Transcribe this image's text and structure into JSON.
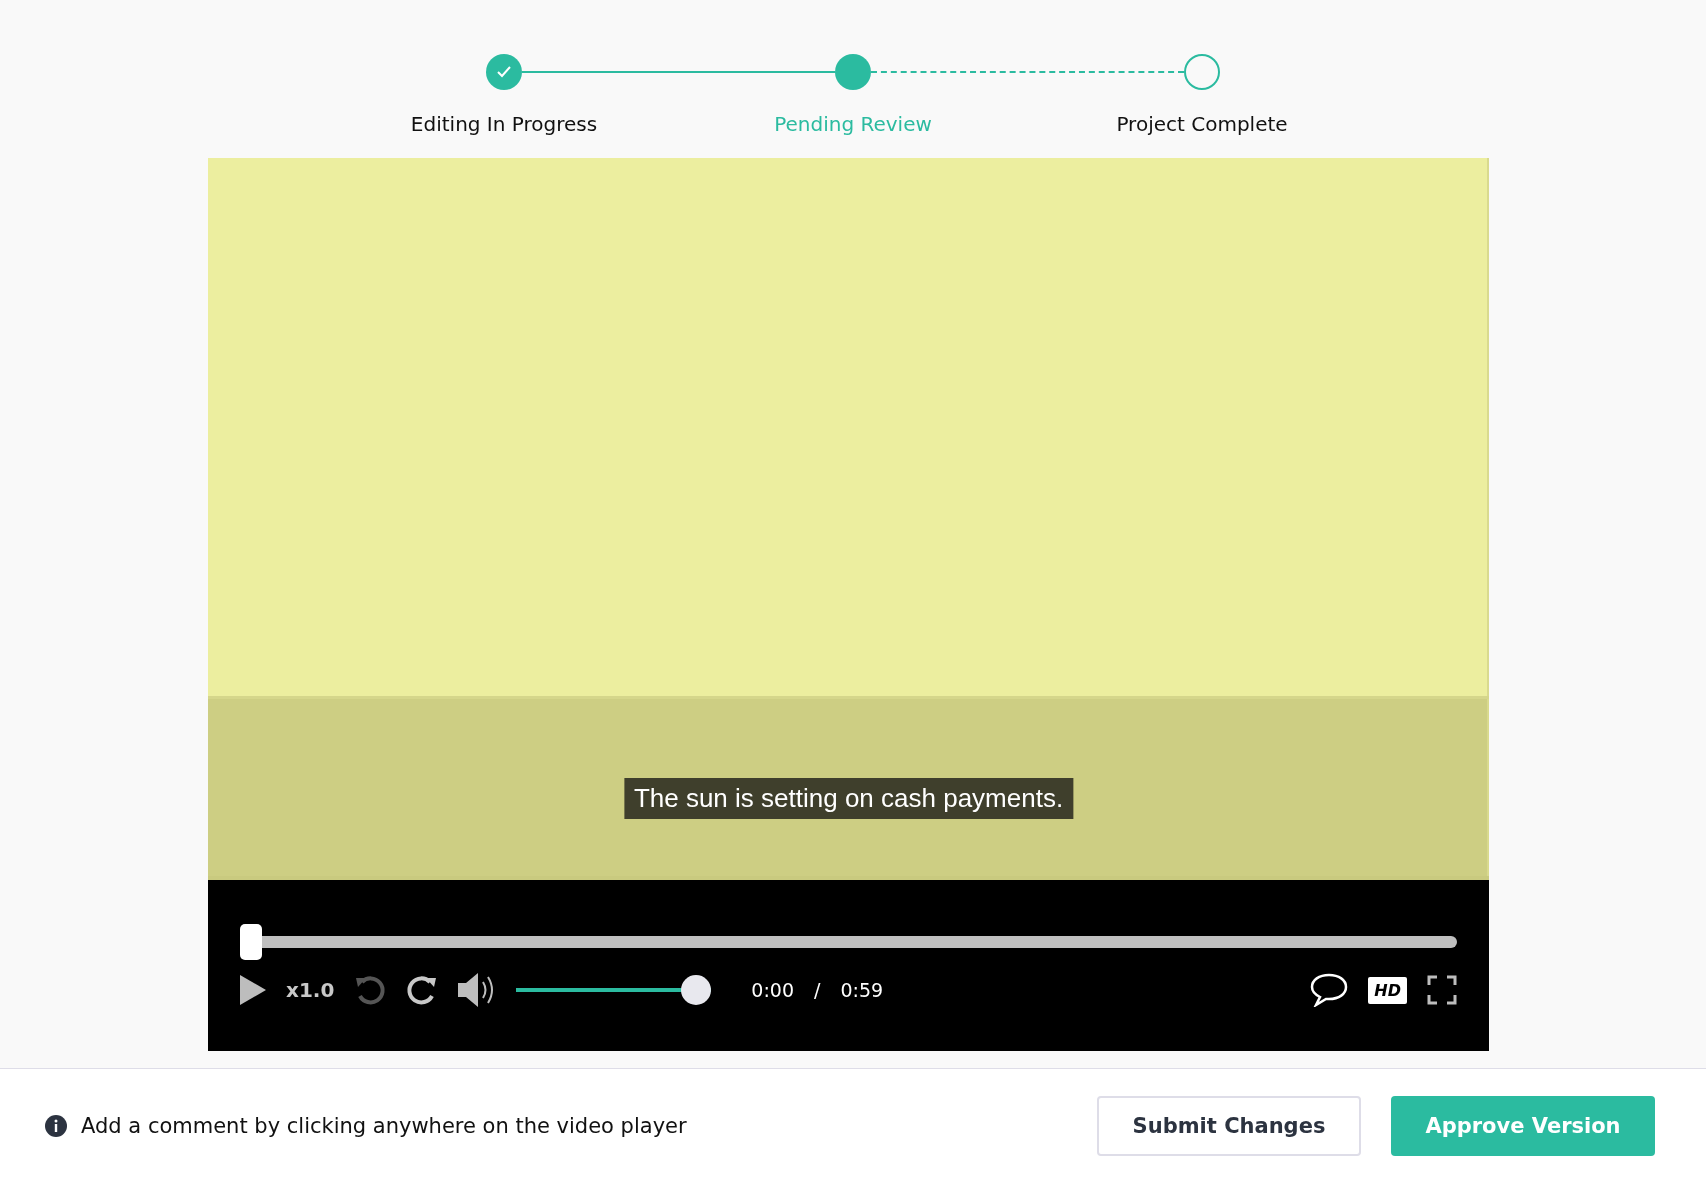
{
  "steps": [
    {
      "label": "Editing In Progress",
      "completed": true,
      "selected": false
    },
    {
      "label": "Pending Review",
      "completed": false,
      "selected": true
    },
    {
      "label": "Project Complete",
      "completed": false,
      "selected": false
    }
  ],
  "player": {
    "caption": "The sun is setting on cash payments.",
    "progress": {
      "level": 0
    },
    "speed": "x1.0",
    "volume": {
      "level": 1
    },
    "time_current": "0:00",
    "time_separator": "/",
    "time_total": "0:59",
    "hd": "HD"
  },
  "footer": {
    "hint": "Add a comment by clicking anywhere on the video player",
    "buttons": [
      {
        "label": "Submit Changes",
        "kind": "secondary"
      },
      {
        "label": "Approve Version",
        "kind": "primary"
      }
    ]
  }
}
